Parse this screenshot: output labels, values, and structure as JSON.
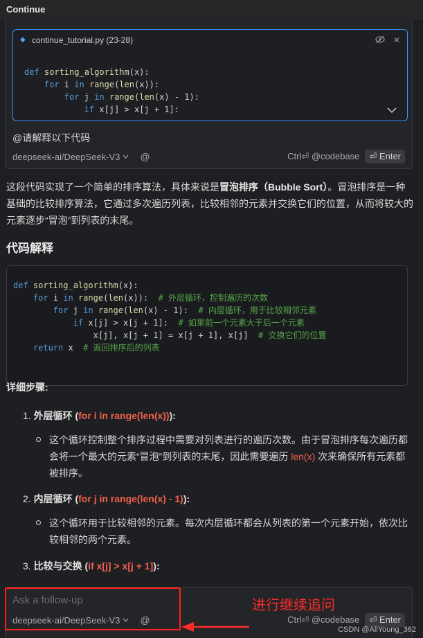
{
  "window": {
    "title": "Continue"
  },
  "input_top": {
    "context": {
      "file_label": "continue_tutorial.py (23-28)",
      "code_lines": [
        {
          "indent": "",
          "parts": [
            [
              "kw",
              "def "
            ],
            [
              "fn",
              "sorting_algorithm"
            ],
            [
              "",
              "(x):"
            ]
          ]
        },
        {
          "indent": "    ",
          "parts": [
            [
              "kw",
              "for "
            ],
            [
              "",
              "i "
            ],
            [
              "kw",
              "in "
            ],
            [
              "fn",
              "range"
            ],
            [
              "",
              "("
            ],
            [
              "fn",
              "len"
            ],
            [
              "",
              "(x)):"
            ]
          ]
        },
        {
          "indent": "        ",
          "parts": [
            [
              "kw",
              "for "
            ],
            [
              "",
              "j "
            ],
            [
              "kw",
              "in "
            ],
            [
              "fn",
              "range"
            ],
            [
              "",
              "("
            ],
            [
              "fn",
              "len"
            ],
            [
              "",
              "(x) - 1):"
            ]
          ]
        },
        {
          "indent": "            ",
          "parts": [
            [
              "kw",
              "if "
            ],
            [
              "",
              "x[j] > x[j + 1]:"
            ]
          ]
        }
      ]
    },
    "question": "@请解释以下代码",
    "model": "deepseek-ai/DeepSeek-V3",
    "at_symbol": "@",
    "shortcut": "Ctrl⏎ @codebase",
    "enter_label": "⏎ Enter"
  },
  "response": {
    "intro_a": "这段代码实现了一个简单的排序算法，具体来说是",
    "intro_b": "冒泡排序（Bubble Sort）",
    "intro_c": "。冒泡排序是一种基础的比较排序算法，它通过多次遍历列表，比较相邻的元素并交换它们的位置，从而将较大的元素逐步“冒泡”到列表的末尾。",
    "heading": "代码解释",
    "code_lines": [
      {
        "indent": "",
        "parts": [
          [
            "kw",
            "def "
          ],
          [
            "fn",
            "sorting_algorithm"
          ],
          [
            "",
            "(x):"
          ]
        ]
      },
      {
        "indent": "    ",
        "parts": [
          [
            "kw",
            "for "
          ],
          [
            "",
            "i "
          ],
          [
            "kw",
            "in "
          ],
          [
            "fn",
            "range"
          ],
          [
            "",
            "("
          ],
          [
            "fn",
            "len"
          ],
          [
            "",
            "(x)):  "
          ],
          [
            "cm",
            "# 外层循环，控制遍历的次数"
          ]
        ]
      },
      {
        "indent": "        ",
        "parts": [
          [
            "kw",
            "for "
          ],
          [
            "",
            "j "
          ],
          [
            "kw",
            "in "
          ],
          [
            "fn",
            "range"
          ],
          [
            "",
            "("
          ],
          [
            "fn",
            "len"
          ],
          [
            "",
            "(x) - 1):  "
          ],
          [
            "cm",
            "# 内层循环，用于比较相邻元素"
          ]
        ]
      },
      {
        "indent": "            ",
        "parts": [
          [
            "kw",
            "if "
          ],
          [
            "",
            "x[j] > x[j + 1]:  "
          ],
          [
            "cm",
            "# 如果前一个元素大于后一个元素"
          ]
        ]
      },
      {
        "indent": "                ",
        "parts": [
          [
            "",
            "x[j], x[j + 1] = x[j + 1], x[j]  "
          ],
          [
            "cm",
            "# 交换它们的位置"
          ]
        ]
      },
      {
        "indent": "    ",
        "parts": [
          [
            "kw",
            "return "
          ],
          [
            "",
            "x  "
          ],
          [
            "cm",
            "# 返回排序后的列表"
          ]
        ]
      }
    ],
    "steps_title": "详细步骤:",
    "steps": [
      {
        "num": "1.",
        "label": "外层循环",
        "code": "for i in range(len(x))",
        "detail_a": "这个循环控制整个排序过程中需要对列表进行的遍历次数。由于冒泡排序每次遍历都会将一个最大的元素“冒泡”到列表的末尾，因此需要遍历 ",
        "detail_code": "len(x)",
        "detail_b": " 次来确保所有元素都被排序。"
      },
      {
        "num": "2.",
        "label": "内层循环",
        "code": "for j in range(len(x) - 1)",
        "detail_a": "这个循环用于比较相邻的元素。每次内层循环都会从列表的第一个元素开始，依次比较相邻的两个元素。",
        "detail_code": "",
        "detail_b": ""
      },
      {
        "num": "3.",
        "label": "比较与交换",
        "code": "if x[j] > x[j + 1]"
      }
    ]
  },
  "followup": {
    "placeholder": "Ask a follow-up",
    "model": "deepseek-ai/DeepSeek-V3",
    "at_symbol": "@",
    "shortcut": "Ctrl⏎ @codebase",
    "enter_label": "⏎ Enter"
  },
  "annotation": {
    "text": "进行继续追问",
    "color": "#ff2a2a"
  },
  "watermark": "CSDN @AllYoung_362"
}
